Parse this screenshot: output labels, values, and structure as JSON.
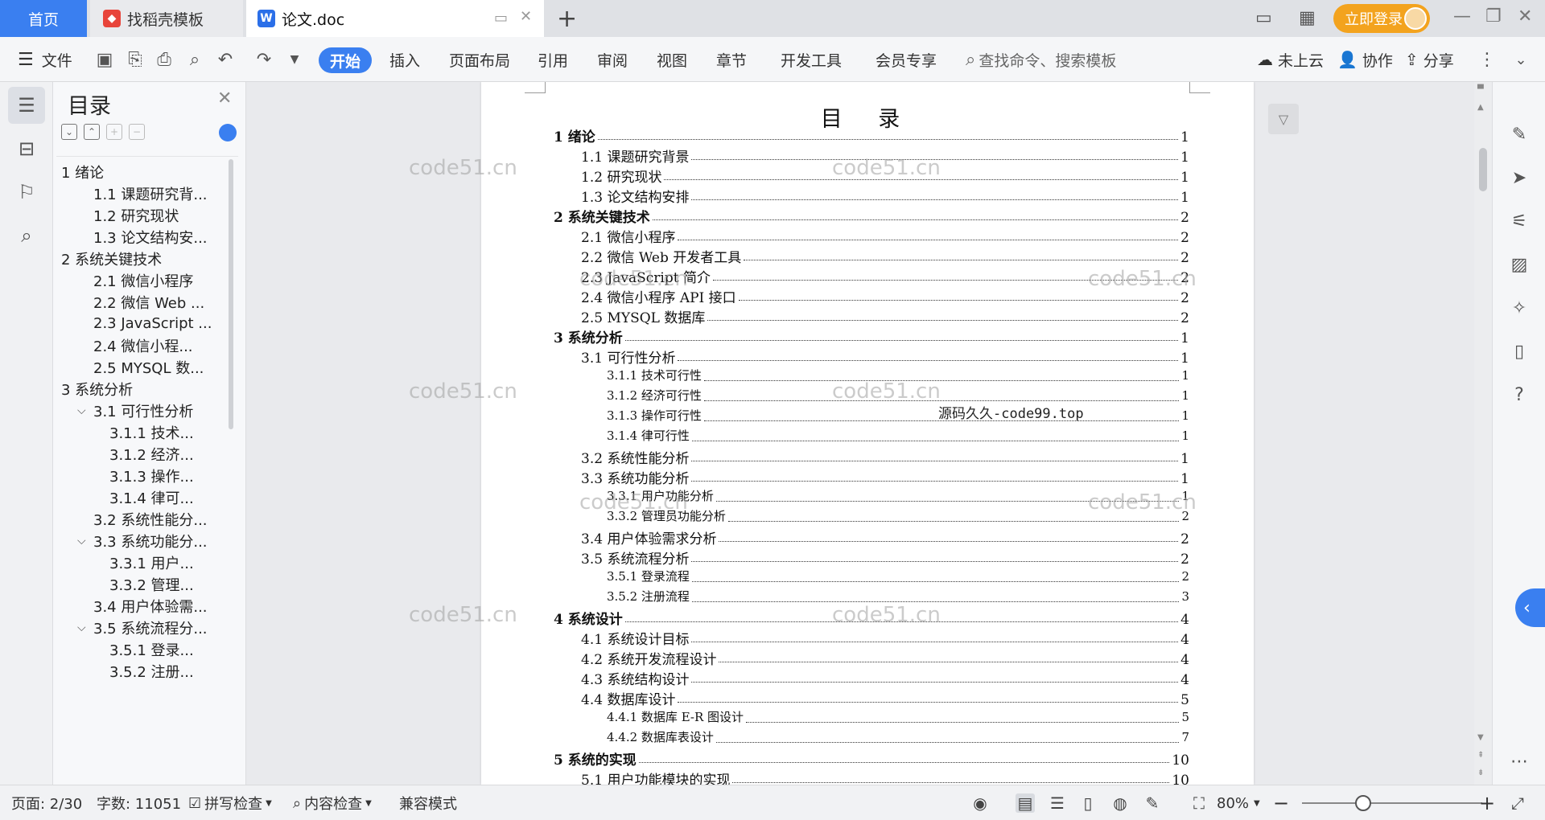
{
  "tabs": {
    "home": "首页",
    "template": "找稻壳模板",
    "document": "论文.doc",
    "login": "立即登录"
  },
  "ribbon": {
    "file": "文件",
    "menus": [
      "开始",
      "插入",
      "页面布局",
      "引用",
      "审阅",
      "视图",
      "章节",
      "开发工具",
      "会员专享"
    ],
    "search_placeholder": "查找命令、搜索模板",
    "cloud": "未上云",
    "collab": "协作",
    "share": "分享"
  },
  "sidebar": {
    "title": "目录",
    "items": [
      {
        "level": 1,
        "label": "1  绪论",
        "expandable": true
      },
      {
        "level": 2,
        "label": "1.1  课题研究背..."
      },
      {
        "level": 2,
        "label": "1.2  研究现状"
      },
      {
        "level": 2,
        "label": "1.3  论文结构安..."
      },
      {
        "level": 1,
        "label": "2  系统关键技术",
        "expandable": true
      },
      {
        "level": 2,
        "label": "2.1  微信小程序"
      },
      {
        "level": 2,
        "label": "2.2  微信 Web ..."
      },
      {
        "level": 2,
        "label": "2.3 JavaScript ..."
      },
      {
        "level": 2,
        "label": "2.4  微信小程..."
      },
      {
        "level": 2,
        "label": "2.5 MYSQL 数..."
      },
      {
        "level": 1,
        "label": "3  系统分析",
        "expandable": true
      },
      {
        "level": 2,
        "label": "3.1  可行性分析",
        "expandable": true
      },
      {
        "level": 3,
        "label": "3.1.1  技术..."
      },
      {
        "level": 3,
        "label": "3.1.2  经济..."
      },
      {
        "level": 3,
        "label": "3.1.3  操作..."
      },
      {
        "level": 3,
        "label": "3.1.4  律可..."
      },
      {
        "level": 2,
        "label": "3.2  系统性能分..."
      },
      {
        "level": 2,
        "label": "3.3  系统功能分...",
        "expandable": true
      },
      {
        "level": 3,
        "label": "3.3.1  用户..."
      },
      {
        "level": 3,
        "label": "3.3.2  管理..."
      },
      {
        "level": 2,
        "label": "3.4  用户体验需..."
      },
      {
        "level": 2,
        "label": "3.5  系统流程分...",
        "expandable": true
      },
      {
        "level": 3,
        "label": "3.5.1  登录..."
      },
      {
        "level": 3,
        "label": "3.5.2  注册..."
      }
    ]
  },
  "document": {
    "toc_title": "目 录",
    "entries": [
      {
        "level": 1,
        "text": "1  绪论",
        "page": "1"
      },
      {
        "level": 2,
        "text": "1.1  课题研究背景",
        "page": "1"
      },
      {
        "level": 2,
        "text": "1.2  研究现状",
        "page": "1"
      },
      {
        "level": 2,
        "text": "1.3  论文结构安排",
        "page": "1"
      },
      {
        "level": 1,
        "text": "2  系统关键技术",
        "page": "2"
      },
      {
        "level": 2,
        "text": "2.1  微信小程序",
        "page": "2"
      },
      {
        "level": 2,
        "text": "2.2  微信 Web 开发者工具",
        "page": "2"
      },
      {
        "level": 2,
        "text": "2.3 JavaScript 简介",
        "page": "2"
      },
      {
        "level": 2,
        "text": "2.4  微信小程序 API 接口",
        "page": "2"
      },
      {
        "level": 2,
        "text": "2.5 MYSQL 数据库",
        "page": "2"
      },
      {
        "level": 1,
        "text": "3  系统分析",
        "page": "1"
      },
      {
        "level": 2,
        "text": "3.1  可行性分析",
        "page": "1"
      },
      {
        "level": 3,
        "text": "3.1.1  技术可行性",
        "page": "1"
      },
      {
        "level": 3,
        "text": "3.1.2  经济可行性",
        "page": "1"
      },
      {
        "level": 3,
        "text": "3.1.3  操作可行性",
        "page": "1"
      },
      {
        "level": 3,
        "text": "3.1.4  律可行性",
        "page": "1"
      },
      {
        "level": 2,
        "text": "3.2  系统性能分析",
        "page": "1"
      },
      {
        "level": 2,
        "text": "3.3  系统功能分析",
        "page": "1"
      },
      {
        "level": 3,
        "text": "3.3.1  用户功能分析",
        "page": "1"
      },
      {
        "level": 3,
        "text": "3.3.2  管理员功能分析",
        "page": "2"
      },
      {
        "level": 2,
        "text": "3.4  用户体验需求分析",
        "page": "2"
      },
      {
        "level": 2,
        "text": "3.5  系统流程分析",
        "page": "2"
      },
      {
        "level": 3,
        "text": "3.5.1  登录流程",
        "page": "2"
      },
      {
        "level": 3,
        "text": "3.5.2  注册流程",
        "page": "3"
      },
      {
        "level": 1,
        "text": "4  系统设计",
        "page": "4"
      },
      {
        "level": 2,
        "text": "4.1  系统设计目标",
        "page": "4"
      },
      {
        "level": 2,
        "text": "4.2  系统开发流程设计",
        "page": "4"
      },
      {
        "level": 2,
        "text": "4.3  系统结构设计",
        "page": "4"
      },
      {
        "level": 2,
        "text": "4.4  数据库设计",
        "page": "5"
      },
      {
        "level": 3,
        "text": "4.4.1  数据库 E-R 图设计",
        "page": "5"
      },
      {
        "level": 3,
        "text": "4.4.2  数据库表设计",
        "page": "7"
      },
      {
        "level": 1,
        "text": "5  系统的实现",
        "page": "10"
      },
      {
        "level": 2,
        "text": "5.1  用户功能模块的实现",
        "page": "10"
      }
    ],
    "overlay_text": "源码久久-code99.top",
    "watermark": "code51.cn"
  },
  "status": {
    "page": "页面: 2/30",
    "words": "字数: 11051",
    "spell_check": "拼写检查",
    "content_check": "内容检查",
    "compat_mode": "兼容模式",
    "zoom": "80%"
  },
  "colors": {
    "accent": "#3a7ff0",
    "login": "#f3a31e"
  }
}
